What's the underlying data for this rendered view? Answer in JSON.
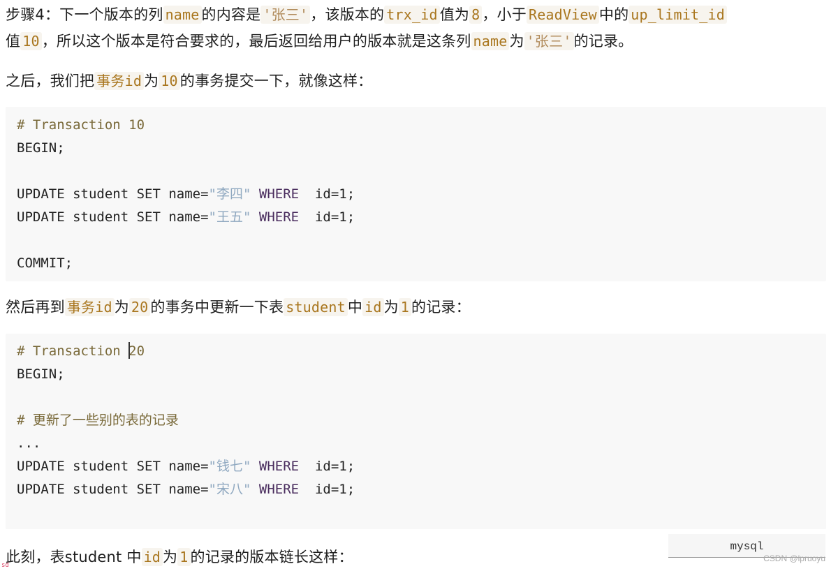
{
  "paragraphs": {
    "p1": {
      "t1": "步骤4：下一个版本的列",
      "c1": "name",
      "t2": "的内容是",
      "c2": "'张三'",
      "t3": "，该版本的",
      "c3": "trx_id",
      "t4": "值为",
      "c4": "8",
      "t5": "，小于",
      "c5": "ReadView",
      "t6": "中的",
      "c6": "up_limit_id",
      "t7": "值",
      "c7": "10",
      "t8": "，所以这个版本是符合要求的，最后返回给用户的版本就是这条列",
      "c8": "name",
      "t9": "为",
      "c9": "'张三'",
      "t10": "的记录。"
    },
    "p2": {
      "t1": "之后，我们把",
      "c1": "事务id",
      "t2": "为",
      "c2": "10",
      "t3": "的事务提交一下，就像这样："
    },
    "p3": {
      "t1": "然后再到",
      "c1": "事务id",
      "t2": "为",
      "c2": "20",
      "t3": "的事务中更新一下表",
      "c3": "student",
      "t4": "中",
      "c4": "id",
      "t5": "为",
      "c5": "1",
      "t6": "的记录："
    },
    "p4": {
      "t1": "此刻，表student 中",
      "c1": "id",
      "t2": "为",
      "c2": "1",
      "t3": "的记录的版本链长这样："
    }
  },
  "code_block_1": {
    "comment": "# Transaction 10",
    "begin": "BEGIN;",
    "update1": {
      "pre": "UPDATE student SET name=",
      "str": "\"李四\"",
      "kw": " WHERE",
      "post": "  id=1;"
    },
    "update2": {
      "pre": "UPDATE student SET name=",
      "str": "\"王五\"",
      "kw": " WHERE",
      "post": "  id=1;"
    },
    "commit": "COMMIT;"
  },
  "code_block_2": {
    "comment_pre": "# Transaction ",
    "comment_post": "20",
    "begin": "BEGIN;",
    "comment2": "# 更新了一些别的表的记录",
    "ellipsis": "...",
    "update1": {
      "pre": "UPDATE student SET name=",
      "str": "\"钱七\"",
      "kw": " WHERE",
      "post": "  id=1;"
    },
    "update2": {
      "pre": "UPDATE student SET name=",
      "str": "\"宋八\"",
      "kw": " WHERE",
      "post": "  id=1;"
    }
  },
  "lang_tag": "mysql",
  "watermark": "CSDN @lpruoyu",
  "corner_mark": "sd"
}
